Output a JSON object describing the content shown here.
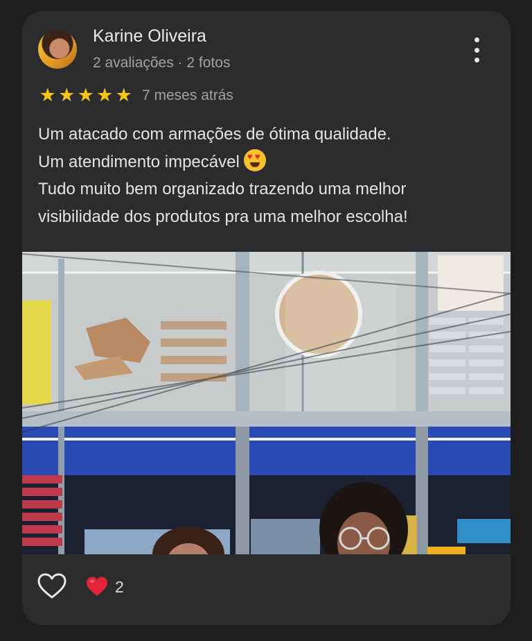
{
  "review": {
    "author": "Karine Oliveira",
    "author_meta": "2 avaliações · 2 fotos",
    "rating": 5,
    "stars": [
      "★",
      "★",
      "★",
      "★",
      "★"
    ],
    "time": "7 meses atrás",
    "text_lines": [
      "Um atacado com armações de ótima qualidade.",
      "Um atendimento impecável",
      "Tudo muito bem organizado trazendo uma melhor",
      "visibilidade dos produtos pra uma melhor escolha!"
    ],
    "text_emoji": "heart-eyes-emoji",
    "menu_icon": "more-vert-icon"
  },
  "reactions": {
    "like_icon": "heart-outline-icon",
    "reaction_icon": "red-heart-icon",
    "count": "2"
  },
  "colors": {
    "background": "#1e1e1f",
    "card": "#2c2c2e",
    "star": "#f5c518",
    "heart": "#e2233a"
  }
}
